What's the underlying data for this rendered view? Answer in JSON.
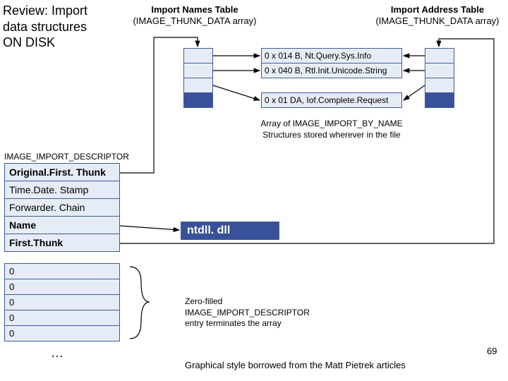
{
  "title": "Review: Import data structures ON DISK",
  "headers": {
    "int": {
      "line1": "Import Names Table",
      "line2": "(IMAGE_THUNK_DATA array)"
    },
    "iat": {
      "line1": "Import Address Table",
      "line2": "(IMAGE_THUNK_DATA array)"
    }
  },
  "ibn": {
    "rows": [
      "0 x 014 B, Nt.Query.Sys.Info",
      "0 x 040 B, Rtl.Init.Unicode.String",
      "0 x 01 DA, Iof.Complete.Request"
    ],
    "caption_line1": "Array of IMAGE_IMPORT_BY_NAME",
    "caption_line2": "Structures stored wherever in the file"
  },
  "iid_label": "IMAGE_IMPORT_DESCRIPTOR",
  "descriptor": [
    {
      "label": "Original.First. Thunk",
      "bold": true
    },
    {
      "label": "Time.Date. Stamp",
      "bold": false
    },
    {
      "label": "Forwarder. Chain",
      "bold": false
    },
    {
      "label": "Name",
      "bold": true
    },
    {
      "label": "First.Thunk",
      "bold": true
    }
  ],
  "dll_name": "ntdll. dll",
  "zeros": [
    "0",
    "0",
    "0",
    "0",
    "0"
  ],
  "zero_caption_l1": "Zero-filled",
  "zero_caption_l2": "IMAGE_IMPORT_DESCRIPTOR",
  "zero_caption_l3": "entry terminates the array",
  "ellipsis": "…",
  "footer": "Graphical style borrowed from the Matt Pietrek articles",
  "page": "69"
}
